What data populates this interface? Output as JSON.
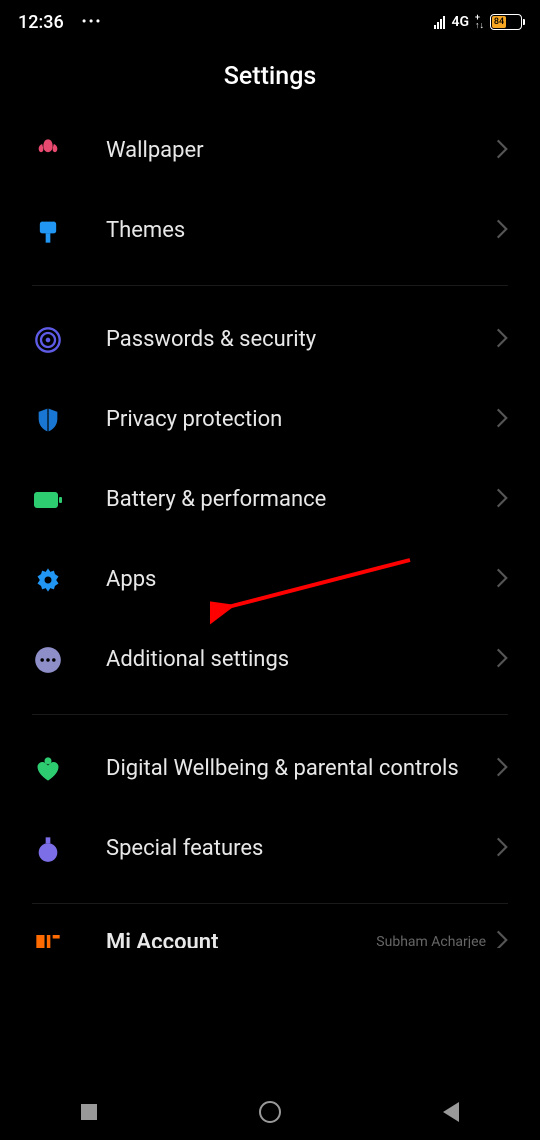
{
  "status_bar": {
    "time": "12:36",
    "network_type": "4G",
    "battery_pct": "84"
  },
  "page_title": "Settings",
  "groups": [
    {
      "items": [
        {
          "label": "Wallpaper",
          "icon": "tulip",
          "color": "#e84a6f"
        },
        {
          "label": "Themes",
          "icon": "brush",
          "color": "#2196f3"
        }
      ]
    },
    {
      "items": [
        {
          "label": "Passwords & security",
          "icon": "fingerprint",
          "color": "#5e5ce6"
        },
        {
          "label": "Privacy protection",
          "icon": "shield",
          "color": "#1976d2"
        },
        {
          "label": "Battery & performance",
          "icon": "battery",
          "color": "#2ecc71"
        },
        {
          "label": "Apps",
          "icon": "gear",
          "color": "#2196f3"
        },
        {
          "label": "Additional settings",
          "icon": "dots",
          "color": "#8e8ec9"
        }
      ]
    },
    {
      "items": [
        {
          "label": "Digital Wellbeing & parental controls",
          "icon": "heart",
          "color": "#2ecc71"
        },
        {
          "label": "Special features",
          "icon": "flask",
          "color": "#7c6ee6"
        }
      ]
    }
  ],
  "partial_item": {
    "label": "Mi Account",
    "sublabel": "Subham Acharjee"
  }
}
